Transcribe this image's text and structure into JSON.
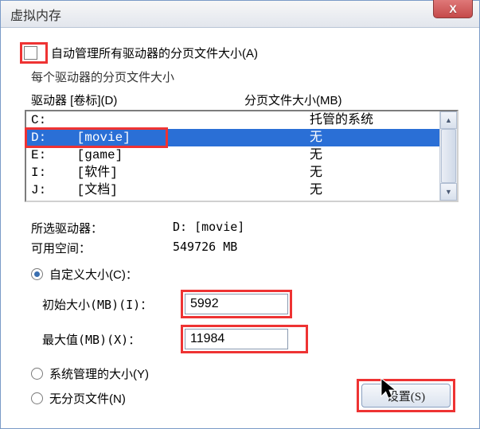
{
  "window": {
    "title": "虚拟内存",
    "close_glyph": "X"
  },
  "auto_manage": {
    "label": "自动管理所有驱动器的分页文件大小(A)"
  },
  "per_drive_label": "每个驱动器的分页文件大小",
  "headers": {
    "drive": "驱动器 [卷标](D)",
    "pagefile": "分页文件大小(MB)"
  },
  "drives": [
    {
      "name": "C:",
      "label": "",
      "pagefile": "托管的系统"
    },
    {
      "name": "D:",
      "label": "[movie]",
      "pagefile": "无"
    },
    {
      "name": "E:",
      "label": "[game]",
      "pagefile": "无"
    },
    {
      "name": "I:",
      "label": "[软件]",
      "pagefile": "无"
    },
    {
      "name": "J:",
      "label": "[文档]",
      "pagefile": "无"
    }
  ],
  "selected_index": 1,
  "selected": {
    "drive_label": "所选驱动器：",
    "drive_value": "D:   [movie]",
    "space_label": "可用空间：",
    "space_value": "549726 MB"
  },
  "size_mode": "custom",
  "custom": {
    "radio_label": "自定义大小(C)：",
    "initial_label": "初始大小(MB)(I)：",
    "initial_value": "5992",
    "max_label": "最大值(MB)(X)：",
    "max_value": "11984"
  },
  "system_managed_label": "系统管理的大小(Y)",
  "no_paging_label": "无分页文件(N)",
  "set_button": "设置(S)",
  "scroll": {
    "up": "▲",
    "down": "▼"
  },
  "red_highlight_color": "#e33"
}
